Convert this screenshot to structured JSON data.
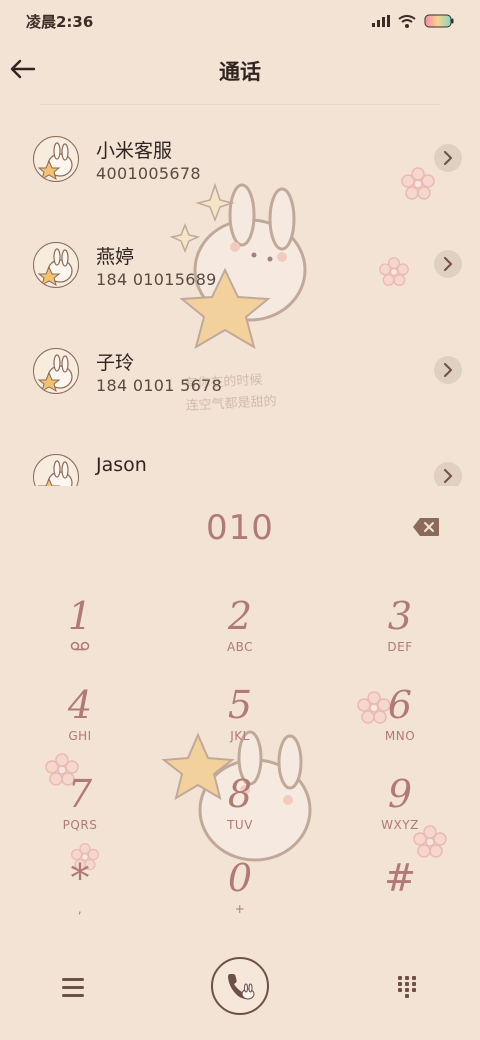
{
  "status_bar": {
    "time": "凌晨2:36"
  },
  "header": {
    "title": "通话"
  },
  "watermark": {
    "line1": "有你在的时候",
    "line2": "连空气都是甜的"
  },
  "call_log": [
    {
      "name": "小米客服",
      "number": "4001005678"
    },
    {
      "name": "燕婷",
      "number": "184 01015689"
    },
    {
      "name": "子玲",
      "number": "184 0101 5678"
    },
    {
      "name": "Jason",
      "number": ""
    }
  ],
  "dialer": {
    "input": "010",
    "keys": [
      {
        "digit": "1",
        "letters": "voicemail-icon"
      },
      {
        "digit": "2",
        "letters": "ABC"
      },
      {
        "digit": "3",
        "letters": "DEF"
      },
      {
        "digit": "4",
        "letters": "GHI"
      },
      {
        "digit": "5",
        "letters": "JKL"
      },
      {
        "digit": "6",
        "letters": "MNO"
      },
      {
        "digit": "7",
        "letters": "PQRS"
      },
      {
        "digit": "8",
        "letters": "TUV"
      },
      {
        "digit": "9",
        "letters": "WXYZ"
      },
      {
        "digit": "*",
        "letters": ","
      },
      {
        "digit": "0",
        "letters": "+"
      },
      {
        "digit": "#",
        "letters": ""
      }
    ]
  },
  "colors": {
    "background": "#f3e3d5",
    "accent": "#b07a75",
    "dark": "#6e5048"
  }
}
